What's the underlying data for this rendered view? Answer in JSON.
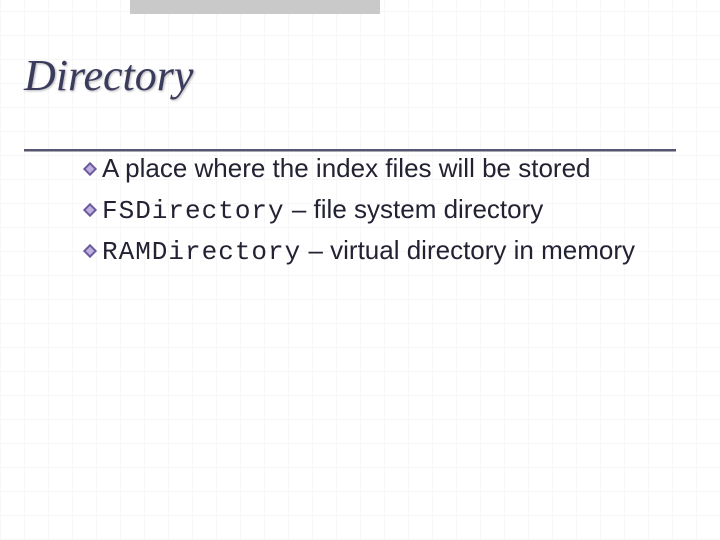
{
  "title": "Directory",
  "bullets": [
    {
      "code": "",
      "text": "A place where the index files will be stored"
    },
    {
      "code": "FSDirectory",
      "text": " – file system directory"
    },
    {
      "code": "RAMDirectory",
      "text": " – virtual directory in memory"
    }
  ]
}
